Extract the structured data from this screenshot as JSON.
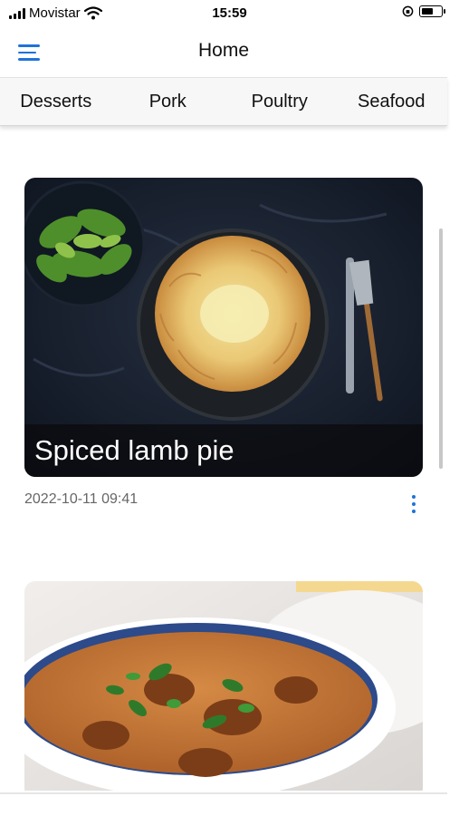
{
  "status_bar": {
    "carrier": "Movistar",
    "time": "15:59",
    "icons": [
      "signal-icon",
      "wifi-icon",
      "orientation-lock-icon",
      "battery-icon"
    ],
    "battery_level": 0.6
  },
  "app_bar": {
    "title": "Home",
    "menu_icon": "hamburger-menu-icon",
    "accent_color": "#1e73d8"
  },
  "categories": [
    "Desserts",
    "Pork",
    "Poultry",
    "Seafood"
  ],
  "recipes": [
    {
      "title": "Spiced lamb pie",
      "date": "2022-10-11 09:41",
      "menu_icon": "more-vert-icon"
    },
    {
      "title": "",
      "date": ""
    }
  ]
}
